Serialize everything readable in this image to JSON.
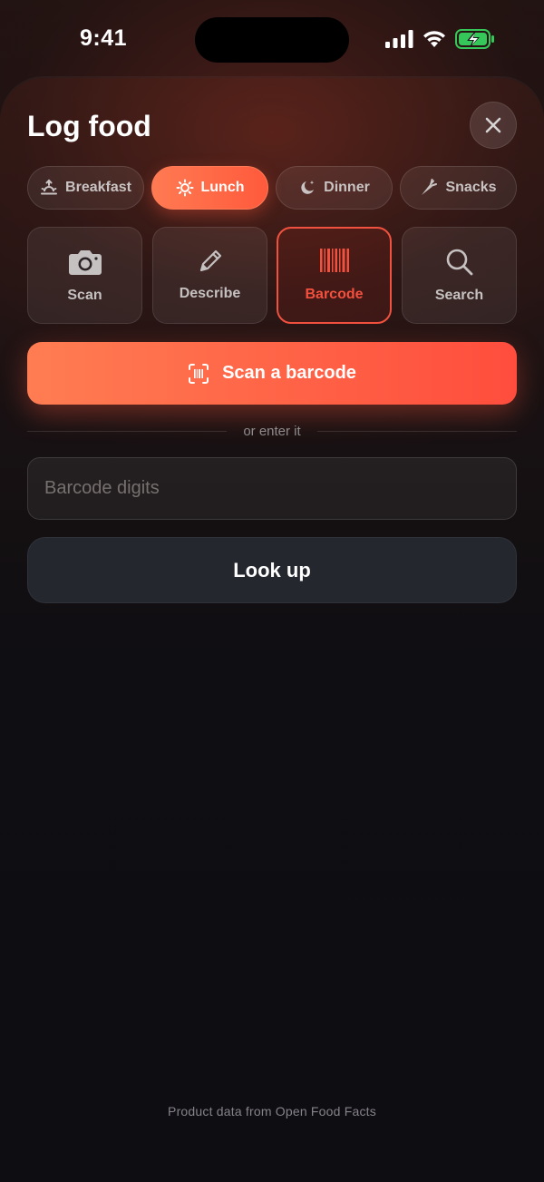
{
  "status_bar": {
    "time": "9:41",
    "icons": [
      "cellular-signal-icon",
      "wifi-icon",
      "battery-charging-icon"
    ]
  },
  "sheet": {
    "title": "Log food",
    "close_icon": "close-icon"
  },
  "meals": [
    {
      "label": "Breakfast",
      "icon": "sunrise-icon",
      "selected": false
    },
    {
      "label": "Lunch",
      "icon": "sun-icon",
      "selected": true
    },
    {
      "label": "Dinner",
      "icon": "moon-stars-icon",
      "selected": false
    },
    {
      "label": "Snacks",
      "icon": "carrot-icon",
      "selected": false
    }
  ],
  "methods": [
    {
      "label": "Scan",
      "icon": "camera-icon",
      "selected": false
    },
    {
      "label": "Describe",
      "icon": "pencil-icon",
      "selected": false
    },
    {
      "label": "Barcode",
      "icon": "barcode-icon",
      "selected": true
    },
    {
      "label": "Search",
      "icon": "search-icon",
      "selected": false
    }
  ],
  "scan_button": {
    "label": "Scan a barcode",
    "icon": "barcode-viewfinder-icon"
  },
  "divider": {
    "text": "or enter it"
  },
  "barcode_input": {
    "placeholder": "Barcode digits",
    "value": ""
  },
  "lookup_button": {
    "label": "Look up"
  },
  "footer": {
    "note": "Product data from Open Food Facts"
  },
  "colors": {
    "accent": "#ff5a3c",
    "accent_gradient_start": "#ff7d52",
    "selected_method_text": "#f4503e",
    "background": "#0e0e12",
    "battery_green": "#35c759"
  }
}
